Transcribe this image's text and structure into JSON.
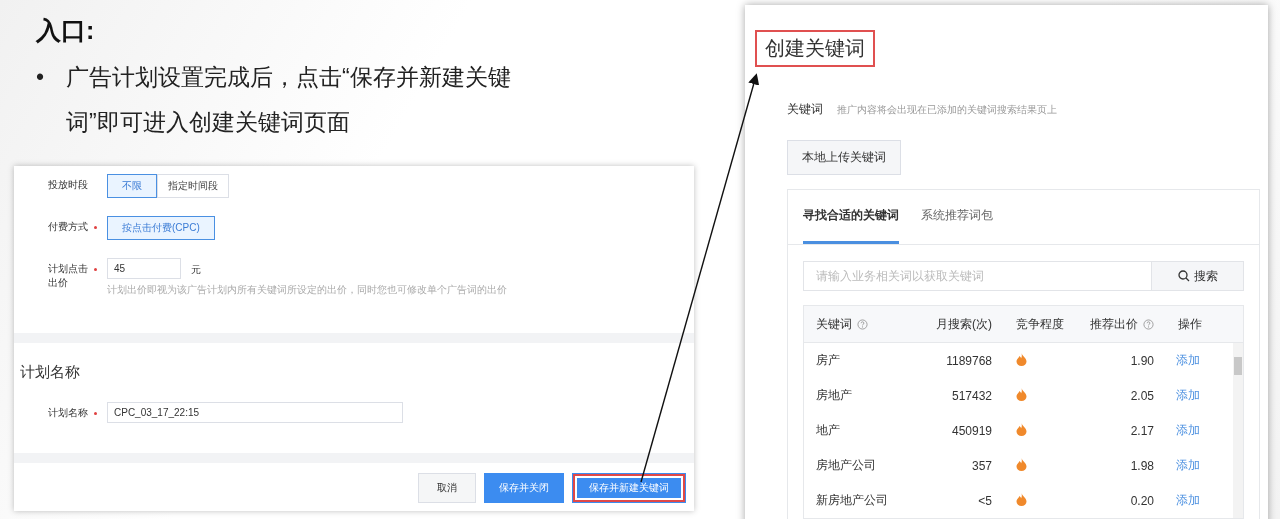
{
  "slide": {
    "title": "入口:",
    "bullet": "•",
    "text": "广告计划设置完成后，点击“保存并新建关键词”即可进入创建关键词页面"
  },
  "plan_form": {
    "fields": [
      {
        "kind": "segmented",
        "label": "投放时段",
        "required": false,
        "options": [
          {
            "label": "不限",
            "selected": true
          },
          {
            "label": "指定时间段",
            "selected": false
          }
        ]
      },
      {
        "kind": "segmented",
        "label": "付费方式",
        "required": true,
        "options": [
          {
            "label": "按点击付费(CPC)",
            "selected": true
          }
        ]
      },
      {
        "kind": "input",
        "label": "计划点击出价",
        "required": true,
        "value": "45",
        "unit": "元",
        "hint": "计划出价即视为该广告计划内所有关键词所设定的出价，同时您也可修改单个广告词的出价"
      }
    ],
    "name_section": {
      "title": "计划名称",
      "label": "计划名称",
      "required": true,
      "value": "CPC_03_17_22:15"
    },
    "buttons": [
      {
        "label": "取消",
        "kind": "default",
        "highlighted": false
      },
      {
        "label": "保存并关闭",
        "kind": "primary",
        "highlighted": false
      },
      {
        "label": "保存并新建关键词",
        "kind": "primary",
        "highlighted": true
      }
    ]
  },
  "keyword_page": {
    "title": "创建关键词",
    "title_highlighted": true,
    "label": "关键词",
    "description": "推广内容将会出现在已添加的关键词搜索结果页上",
    "upload_button": "本地上传关键词",
    "tabs": [
      {
        "label": "寻找合适的关键词",
        "selected": true
      },
      {
        "label": "系统推荐词包",
        "selected": false
      }
    ],
    "search": {
      "placeholder": "请输入业务相关词以获取关键词",
      "button": "搜索"
    },
    "table": {
      "columns": [
        {
          "label": "关键词",
          "help": true
        },
        {
          "label": "月搜索(次)",
          "help": false
        },
        {
          "label": "竞争程度",
          "help": false
        },
        {
          "label": "推荐出价",
          "help": true
        },
        {
          "label": "操作",
          "help": false
        }
      ],
      "rows": [
        {
          "keyword": "房产",
          "monthly": "1189768",
          "bid": "1.90",
          "action": "添加"
        },
        {
          "keyword": "房地产",
          "monthly": "517432",
          "bid": "2.05",
          "action": "添加"
        },
        {
          "keyword": "地产",
          "monthly": "450919",
          "bid": "2.17",
          "action": "添加"
        },
        {
          "keyword": "房地产公司",
          "monthly": "357",
          "bid": "1.98",
          "action": "添加"
        },
        {
          "keyword": "新房地产公司",
          "monthly": "<5",
          "bid": "0.20",
          "action": "添加"
        }
      ]
    }
  }
}
